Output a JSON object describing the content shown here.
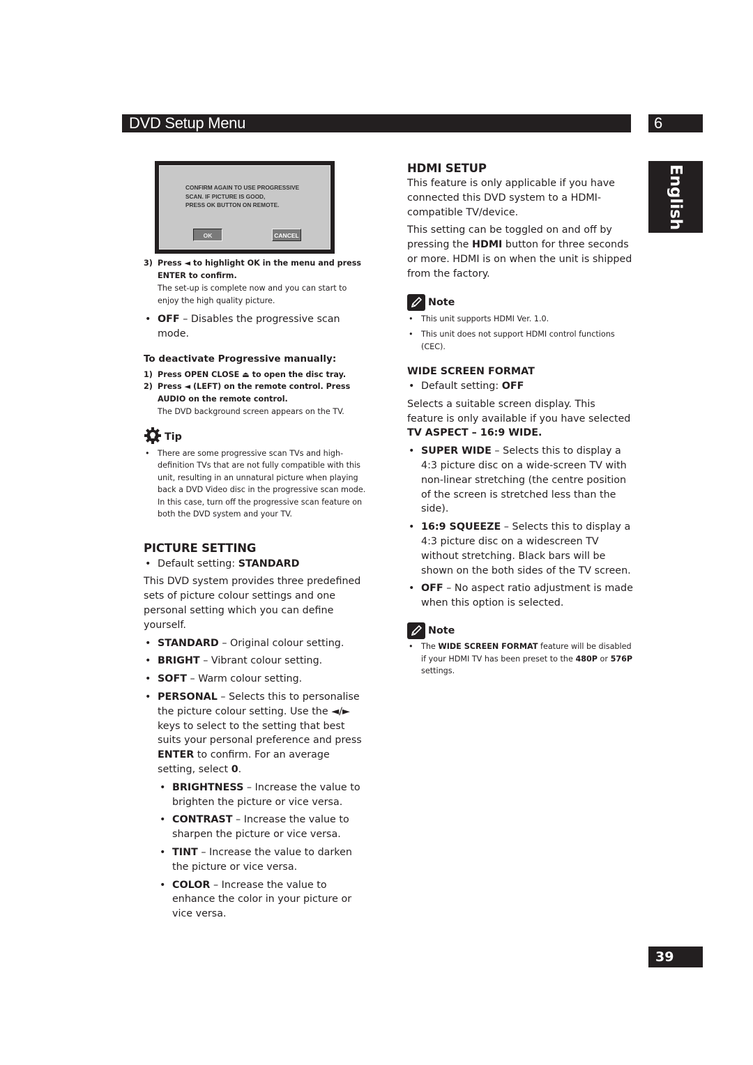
{
  "header": {
    "title": "DVD Setup Menu",
    "chapter": "6",
    "language_tab": "English",
    "page_number": "39"
  },
  "dialog": {
    "message_lines": [
      "CONFIRM AGAIN TO USE PROGRESSIVE",
      "SCAN. IF PICTURE IS GOOD,",
      "PRESS OK BUTTON ON REMOTE."
    ],
    "ok_label": "OK",
    "cancel_label": "CANCEL"
  },
  "left": {
    "step3": {
      "num": "3)",
      "text_bold": "Press ◄ to highlight OK in the menu and press ENTER to confirm.",
      "text": "The set-up is complete now and you can start to enjoy the high quality picture."
    },
    "off_item": {
      "term": "OFF",
      "desc": " – Disables the progressive scan mode."
    },
    "deactivate": {
      "heading": "To deactivate Progressive manually:",
      "steps": [
        {
          "num": "1)",
          "text": "Press OPEN CLOSE ⏏ to open the disc tray."
        },
        {
          "num": "2)",
          "text": "Press ◄ (LEFT) on the remote control. Press AUDIO on the remote control."
        }
      ],
      "result": "The DVD background screen appears on the TV."
    },
    "tip": {
      "label": "Tip",
      "items": [
        "There are some progressive scan TVs and high-definition TVs that are not fully compatible with this unit, resulting in an unnatural picture when playing back a DVD Video disc in the progressive scan mode. In this case, turn off the progressive scan feature on both the DVD system and your TV."
      ]
    },
    "picture_setting": {
      "heading": "PICTURE SETTING",
      "default_prefix": "Default setting: ",
      "default_value": "STANDARD",
      "intro": "This DVD system provides three predefined sets of picture colour settings and one personal setting which you can define yourself.",
      "options": [
        {
          "term": "STANDARD",
          "desc": " – Original colour setting."
        },
        {
          "term": "BRIGHT",
          "desc": " – Vibrant colour setting."
        },
        {
          "term": "SOFT",
          "desc": " – Warm colour setting."
        }
      ],
      "personal": {
        "term": "PERSONAL",
        "desc1": " – Selects this to personalise the picture colour setting. Use the ◄/► keys to select to the setting that best suits your personal preference and press ",
        "enter": "ENTER",
        "desc2": " to confirm. For an average setting, select ",
        "zero": "0",
        "end": "."
      },
      "sub_options": [
        {
          "term": "BRIGHTNESS",
          "desc": " – Increase the value to brighten the picture or vice versa."
        },
        {
          "term": "CONTRAST",
          "desc": " – Increase the value to sharpen the picture or vice versa."
        },
        {
          "term": "TINT",
          "desc": " – Increase the value to darken the picture or vice versa."
        },
        {
          "term": "COLOR",
          "desc": " – Increase the value to enhance the color in your picture or vice versa."
        }
      ]
    }
  },
  "right": {
    "hdmi": {
      "heading": "HDMI SETUP",
      "para1": "This feature is only applicable if you have connected this DVD system to a HDMI-compatible TV/device.",
      "para2_a": "This setting can be toggled on and off by pressing the ",
      "para2_b": "HDMI",
      "para2_c": " button for three seconds or more. HDMI is on when the unit is shipped from the factory.",
      "note_label": "Note",
      "notes": [
        "This unit supports HDMI Ver. 1.0.",
        "This unit does not support HDMI control functions (CEC)."
      ]
    },
    "wide": {
      "heading": "WIDE SCREEN FORMAT",
      "default_prefix": "Default setting: ",
      "default_value": "OFF",
      "intro_a": "Selects a suitable screen display. This feature is only available if you have selected ",
      "intro_b": "TV ASPECT – 16:9 WIDE.",
      "options": [
        {
          "term": "SUPER WIDE",
          "desc": " – Selects this to display a 4:3 picture disc on a wide-screen TV with non-linear stretching (the centre position of the screen is stretched less than the side)."
        },
        {
          "term": "16:9 SQUEEZE",
          "desc": " – Selects this to display a 4:3 picture disc on a widescreen TV without stretching. Black bars will be shown on the both sides of the TV screen."
        },
        {
          "term": "OFF",
          "desc": " – No aspect ratio adjustment is made when this option is selected."
        }
      ],
      "note_label": "Note",
      "note": {
        "a": "The ",
        "b": "WIDE SCREEN FORMAT",
        "c": " feature will be disabled if your HDMI TV has been preset to the ",
        "d": "480P",
        "e": " or ",
        "f": "576P",
        "g": " settings."
      }
    }
  }
}
